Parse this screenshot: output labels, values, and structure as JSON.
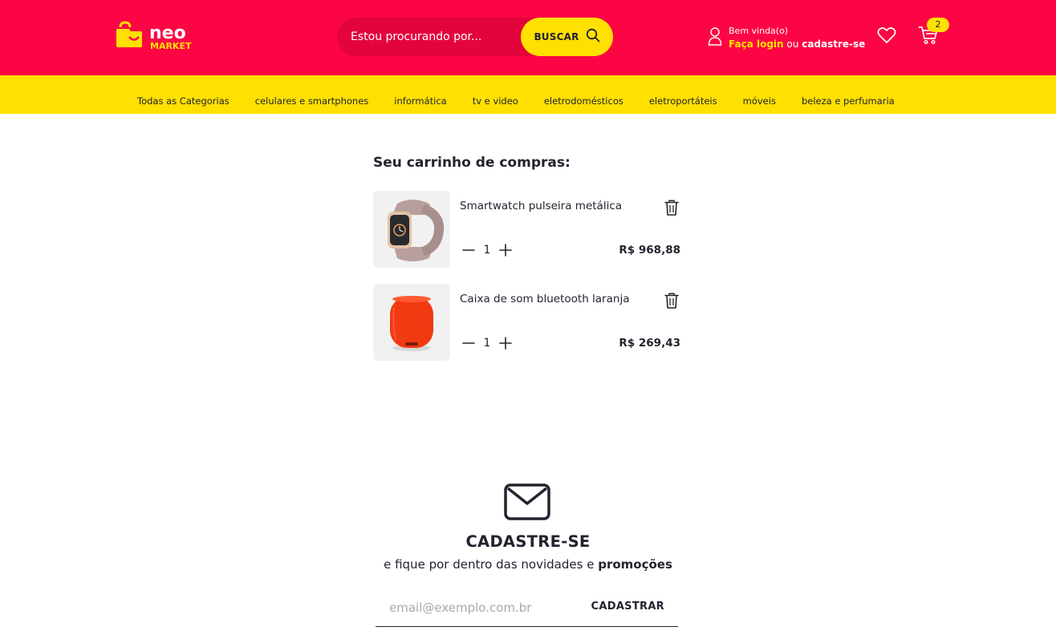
{
  "header": {
    "logo": {
      "brand": "neo",
      "sub": "MARKET"
    },
    "search": {
      "placeholder": "Estou procurando por...",
      "button_label": "BUSCAR"
    },
    "account": {
      "greeting": "Bem vinda(o)",
      "login_label": "Faça login",
      "connector": "ou",
      "signup_label": "cadastre-se"
    },
    "cart_count": "2",
    "colors": {
      "primary": "#fc0544",
      "accent": "#ffe000",
      "text": "#23232f"
    }
  },
  "nav": {
    "items": [
      "Todas as Categorias",
      "celulares e smartphones",
      "informática",
      "tv e video",
      "eletrodomésticos",
      "eletroportáteis",
      "móveis",
      "beleza e perfumaria"
    ]
  },
  "cart": {
    "title": "Seu carrinho de compras:",
    "items": [
      {
        "name": "Smartwatch pulseira metálica",
        "quantity": "1",
        "price": "R$ 968,88",
        "image": "smartwatch-image"
      },
      {
        "name": "Caixa de som bluetooth laranja",
        "quantity": "1",
        "price": "R$ 269,43",
        "image": "speaker-image"
      }
    ]
  },
  "newsletter": {
    "icon": "envelope-icon",
    "title": "CADASTRE-SE",
    "subtitle_prefix": "e fique por dentro das novidades e",
    "subtitle_bold": "promoções",
    "email_placeholder": "email@exemplo.com.br",
    "button_label": "CADASTRAR"
  }
}
